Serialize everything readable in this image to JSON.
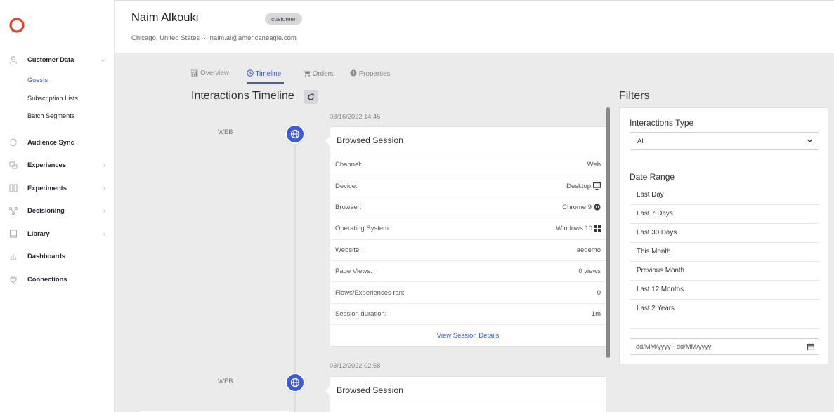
{
  "sidebar": {
    "items": [
      {
        "label": "Customer Data",
        "icon": "user-icon"
      },
      {
        "label": "Audience Sync",
        "icon": "sync-icon"
      },
      {
        "label": "Experiences",
        "icon": "experiences-icon"
      },
      {
        "label": "Experiments",
        "icon": "experiments-icon"
      },
      {
        "label": "Decisioning",
        "icon": "decisioning-icon"
      },
      {
        "label": "Library",
        "icon": "library-icon"
      },
      {
        "label": "Dashboards",
        "icon": "dashboards-icon"
      },
      {
        "label": "Connections",
        "icon": "plug-icon"
      }
    ],
    "sub_items": [
      "Guests",
      "Subscription Lists",
      "Batch Segments"
    ]
  },
  "header": {
    "name": "Naim Alkouki",
    "badge": "customer",
    "location": "Chicago, United States",
    "separator": "·",
    "email": "naim.al@americaneagle.com"
  },
  "tabs": [
    "Overview",
    "Timeline",
    "Orders",
    "Properties"
  ],
  "timeline": {
    "title": "Interactions Timeline",
    "entries": [
      {
        "date": "03/16/2022 14:45",
        "channel": "WEB",
        "title": "Browsed Session",
        "rows": [
          {
            "label": "Channel:",
            "value": "Web"
          },
          {
            "label": "Device:",
            "value": "Desktop"
          },
          {
            "label": "Browser:",
            "value": "Chrome 9"
          },
          {
            "label": "Operating System:",
            "value": "Windows 10"
          },
          {
            "label": "Website:",
            "value": "aedemo"
          },
          {
            "label": "Page Views:",
            "value": "0 views"
          },
          {
            "label": "Flows/Experiences ran:",
            "value": "0"
          },
          {
            "label": "Session duration:",
            "value": "1m"
          }
        ],
        "link": "View Session Details"
      },
      {
        "date": "03/12/2022 02:58",
        "channel": "WEB",
        "title": "Browsed Session"
      }
    ]
  },
  "filters": {
    "title": "Filters",
    "interactions_type_label": "Interactions Type",
    "interactions_type_value": "All",
    "date_range_label": "Date Range",
    "date_ranges": [
      "Last Day",
      "Last 7 Days",
      "Last 30 Days",
      "This Month",
      "Previous Month",
      "Last 12 Months",
      "Last 2 Years"
    ],
    "date_input_placeholder": "dd/MM/yyyy - dd/MM/yyyy"
  },
  "colors": {
    "accent": "#3b5bdb",
    "logo": "#e8402a"
  }
}
